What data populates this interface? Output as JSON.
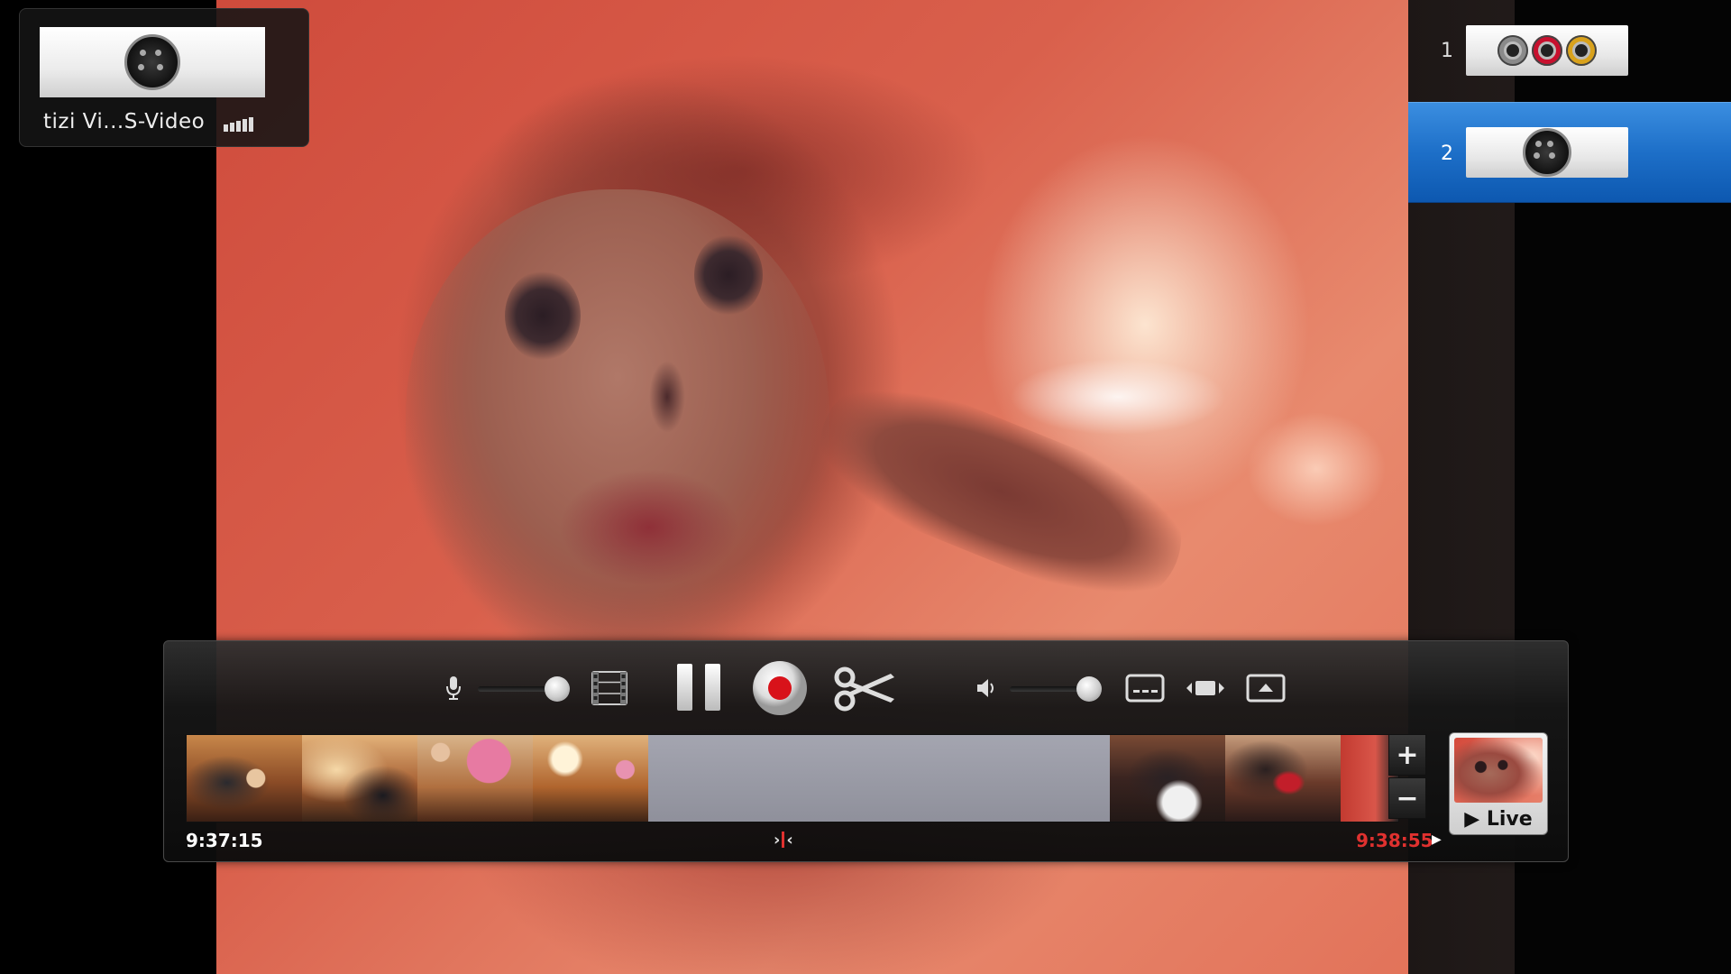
{
  "device": {
    "name": "tizi Vi...S-Video",
    "signal_icon": "signal-bars-icon",
    "signal_level": 1.0
  },
  "sources": [
    {
      "number": "1",
      "icon": "composite-rca-icon",
      "selected": false
    },
    {
      "number": "2",
      "icon": "s-video-icon",
      "selected": true
    }
  ],
  "controls": {
    "mic_icon": "microphone-icon",
    "mic_volume": 0.85,
    "film_icon": "film-strip-icon",
    "pause_icon": "pause-icon",
    "record_icon": "record-icon",
    "cut_icon": "scissors-icon",
    "speaker_icon": "speaker-icon",
    "speaker_volume": 0.85,
    "caption_icon": "captions-icon",
    "aspect_icon": "aspect-ratio-icon",
    "eject_icon": "eject-icon"
  },
  "timeline": {
    "start_time": "9:37:15",
    "end_time": "9:38:55",
    "playhead_left": "›",
    "playhead_right": "‹",
    "end_arrow": "▶",
    "zoom_in": "+",
    "zoom_out": "−"
  },
  "live_button": {
    "label": "▶ Live"
  },
  "colors": {
    "selected_source": "#1d6fc8",
    "record": "#d8121a",
    "end_time": "#e0312f"
  }
}
